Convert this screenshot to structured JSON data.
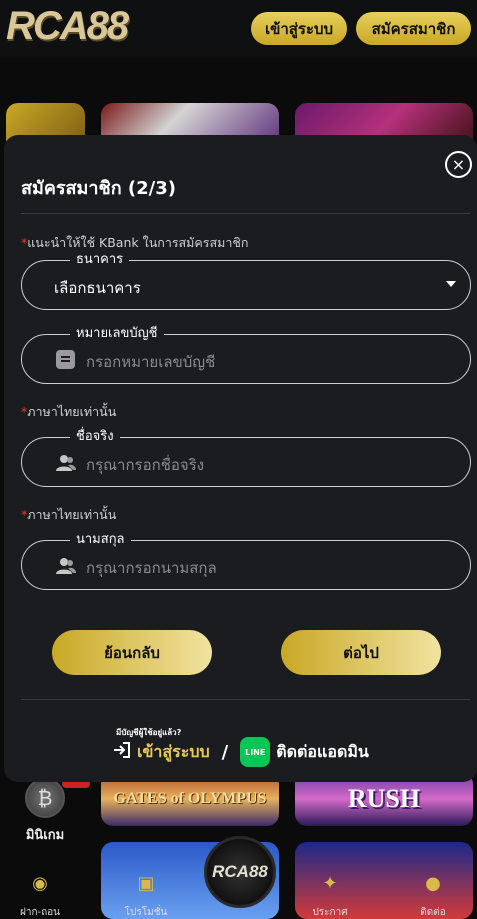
{
  "header": {
    "logo": "RCA88",
    "login_label": "เข้าสู่ระบบ",
    "register_label": "สมัครสมาชิก"
  },
  "background": {
    "tiles": [
      "GATES of OLYMPUS",
      "RUSH"
    ],
    "minigame_label": "มินิเกม"
  },
  "bottom_nav": {
    "deposit_label": "ฝาก-ถอน",
    "promo_label": "โปรโมชั่น",
    "center_logo": "RCA88",
    "news_label": "ประกาศ",
    "contact_label": "ติดต่อ"
  },
  "modal": {
    "title": "สมัครสมาชิก (2/3)",
    "close_icon": "×",
    "bank_hint_star": "*",
    "bank_hint": "แนะนำให้ใช้ KBank ในการสมัครสมาชิก",
    "bank_field": {
      "legend": "ธนาคาร",
      "value": "เลือกธนาคาร"
    },
    "account_field": {
      "legend": "หมายเลขบัญชี",
      "placeholder": "กรอกหมายเลขบัญชี"
    },
    "thai_only_star": "*",
    "thai_only": "ภาษาไทยเท่านั้น",
    "firstname_field": {
      "legend": "ชื่อจริง",
      "placeholder": "กรุณากรอกชื่อจริง"
    },
    "lastname_field": {
      "legend": "นามสกุล",
      "placeholder": "กรุณากรอกนามสกุล"
    },
    "back_label": "ย้อนกลับ",
    "next_label": "ต่อไป",
    "footer_question": "มีบัญชีผู้ใช้อยู่แล้ว?",
    "footer_login": "เข้าสู่ระบบ",
    "footer_slash": "/",
    "line_icon": "LINE",
    "footer_contact": "ติดต่อแอดมิน"
  }
}
